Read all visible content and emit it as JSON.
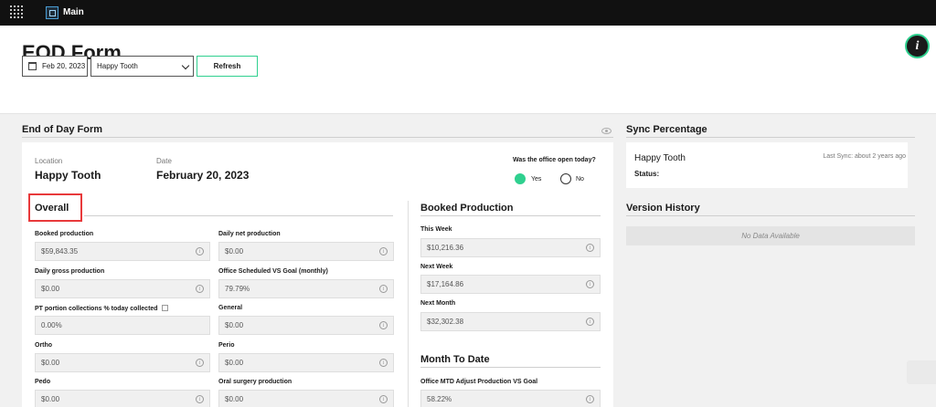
{
  "topbar": {
    "app_name": "Main",
    "menu_icon": "grid-icon",
    "logo_icon": "app-logo-icon"
  },
  "header": {
    "title": "EOD Form",
    "info_label": "i",
    "date_value": "Feb 20, 2023",
    "location_value": "Happy Tooth",
    "refresh_label": "Refresh"
  },
  "form": {
    "title": "End of Day Form",
    "location_label": "Location",
    "location_value": "Happy Tooth",
    "date_label": "Date",
    "date_value": "February 20, 2023",
    "open_question": "Was the office open today?",
    "yes_label": "Yes",
    "no_label": "No",
    "open_selected": "yes",
    "overall_title": "Overall",
    "overall_left": [
      {
        "label": "Booked production",
        "value": "$59,843.35"
      },
      {
        "label": "Daily gross production",
        "value": "$0.00"
      },
      {
        "label": "PT portion collections % today collected",
        "value": "0.00%"
      },
      {
        "label": "Ortho",
        "value": "$0.00"
      },
      {
        "label": "Pedo",
        "value": "$0.00"
      }
    ],
    "overall_right": [
      {
        "label": "Daily net production",
        "value": "$0.00"
      },
      {
        "label": "Office Scheduled VS Goal (monthly)",
        "value": "79.79%"
      },
      {
        "label": "General",
        "value": "$0.00"
      },
      {
        "label": "Perio",
        "value": "$0.00"
      },
      {
        "label": "Oral surgery production",
        "value": "$0.00"
      }
    ],
    "booked_title": "Booked Production",
    "booked": [
      {
        "label": "This Week",
        "value": "$10,216.36"
      },
      {
        "label": "Next Week",
        "value": "$17,164.86"
      },
      {
        "label": "Next Month",
        "value": "$32,302.38"
      }
    ],
    "mtd_title": "Month To Date",
    "mtd": [
      {
        "label": "Office MTD Adjust Production VS Goal",
        "value": "58.22%"
      }
    ]
  },
  "sync": {
    "title": "Sync Percentage",
    "location": "Happy Tooth",
    "last_sync": "Last Sync: about 2 years ago",
    "status_label": "Status:"
  },
  "version": {
    "title": "Version History",
    "empty": "No Data Available"
  },
  "colors": {
    "accent": "#2fd08f",
    "highlight": "#e8393b",
    "topbar": "#111111"
  }
}
